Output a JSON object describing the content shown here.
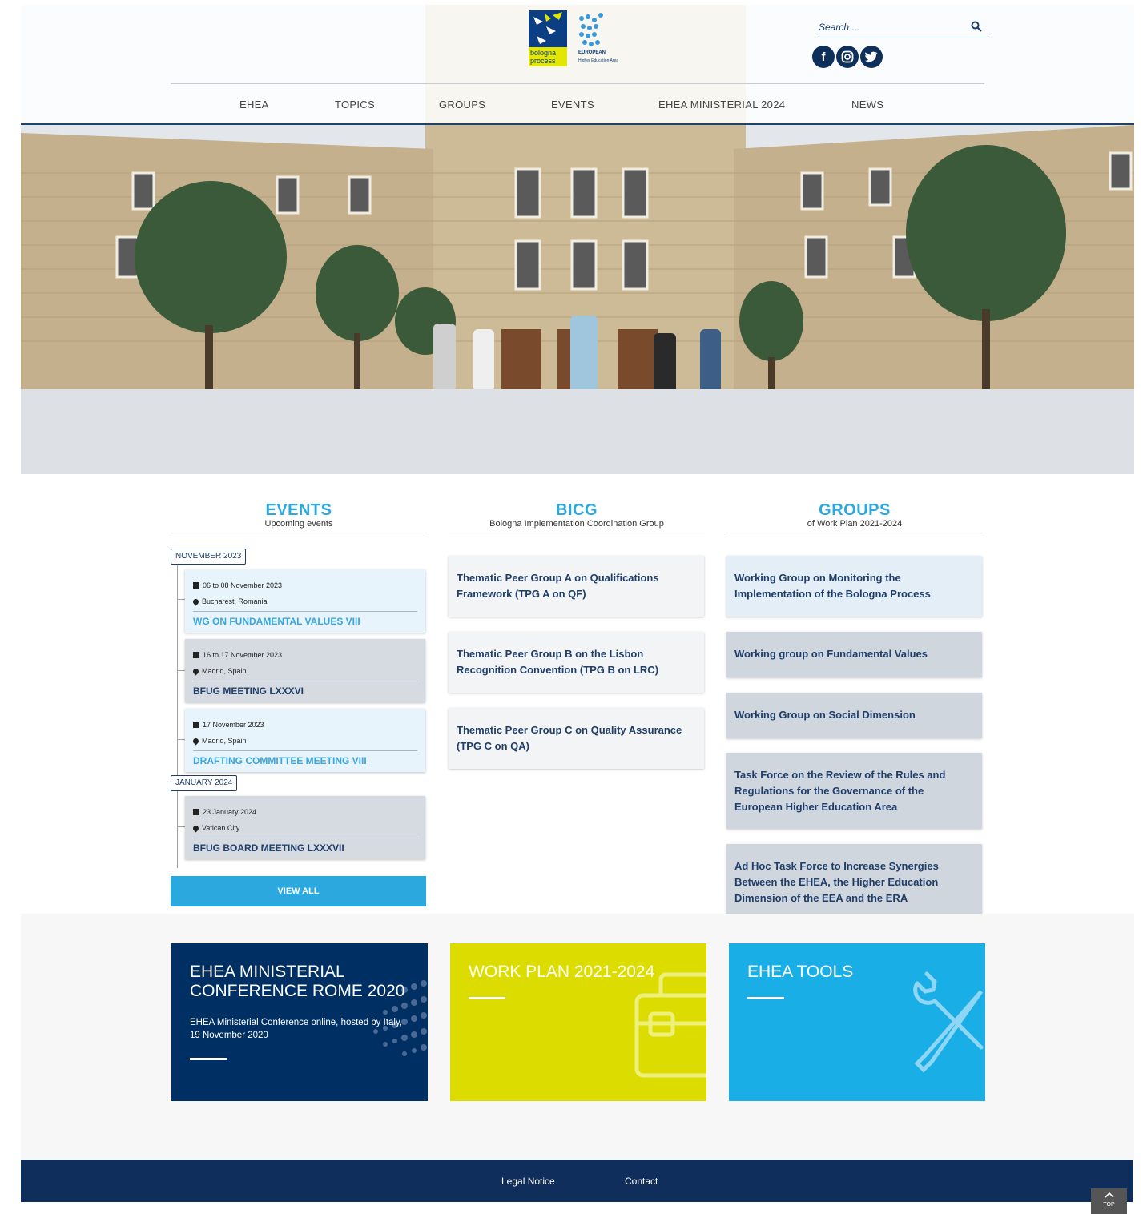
{
  "header": {
    "logo": {
      "brand1_line1": "bologna",
      "brand1_line2": "process",
      "brand2_line1": "EUROPEAN",
      "brand2_line2": "Higher Education Area"
    },
    "search": {
      "placeholder": "Search ..."
    },
    "social": [
      "facebook-icon",
      "instagram-icon",
      "twitter-icon"
    ],
    "nav": [
      "EHEA",
      "TOPICS",
      "GROUPS",
      "EVENTS",
      "EHEA MINISTERIAL 2024",
      "NEWS"
    ]
  },
  "events": {
    "title": "EVENTS",
    "subtitle": "Upcoming events",
    "months": [
      "NOVEMBER 2023",
      "JANUARY 2024"
    ],
    "items": [
      {
        "date": "06 to 08 November 2023",
        "place": "Bucharest, Romania",
        "name": "WG ON FUNDAMENTAL VALUES VIII"
      },
      {
        "date": "16 to 17 November 2023",
        "place": "Madrid, Spain",
        "name": "BFUG MEETING LXXXVI"
      },
      {
        "date": "17 November 2023",
        "place": "Madrid, Spain",
        "name": "DRAFTING COMMITTEE MEETING VIII"
      },
      {
        "date": "23 January 2024",
        "place": "Vatican City",
        "name": "BFUG BOARD MEETING LXXXVII"
      }
    ],
    "view_all": "VIEW ALL"
  },
  "bicg": {
    "title": "BICG",
    "subtitle": "Bologna Implementation Coordination Group",
    "items": [
      "Thematic Peer Group A on Qualifications Framework (TPG A on QF)",
      "Thematic Peer Group B on the Lisbon Recognition Convention (TPG B on LRC)",
      "Thematic Peer Group C on Quality Assurance (TPG C on QA)"
    ]
  },
  "groups": {
    "title": "GROUPS",
    "subtitle": "of Work Plan 2021-2024",
    "items": [
      "Working Group on Monitoring the Implementation of the Bologna Process",
      "Working group on Fundamental Values",
      "Working Group on Social Dimension",
      "Task Force on the Review of the Rules and Regulations for the Governance of the European Higher Education Area",
      "Ad Hoc Task Force to Increase Synergies Between the EHEA, the Higher Education Dimension of the EEA and the ERA"
    ]
  },
  "tiles": [
    {
      "title": "EHEA MINISTERIAL CONFERENCE ROME 2020",
      "desc": "EHEA Ministerial Conference online, hosted by Italy, 19 November 2020",
      "color": "#003063"
    },
    {
      "title": "WORK PLAN 2021-2024",
      "desc": "",
      "color": "#dcdc00"
    },
    {
      "title": "EHEA TOOLS",
      "desc": "",
      "color": "#1aaee6"
    }
  ],
  "footer": {
    "links": [
      "Legal Notice",
      "Contact"
    ],
    "top_label": "TOP"
  }
}
